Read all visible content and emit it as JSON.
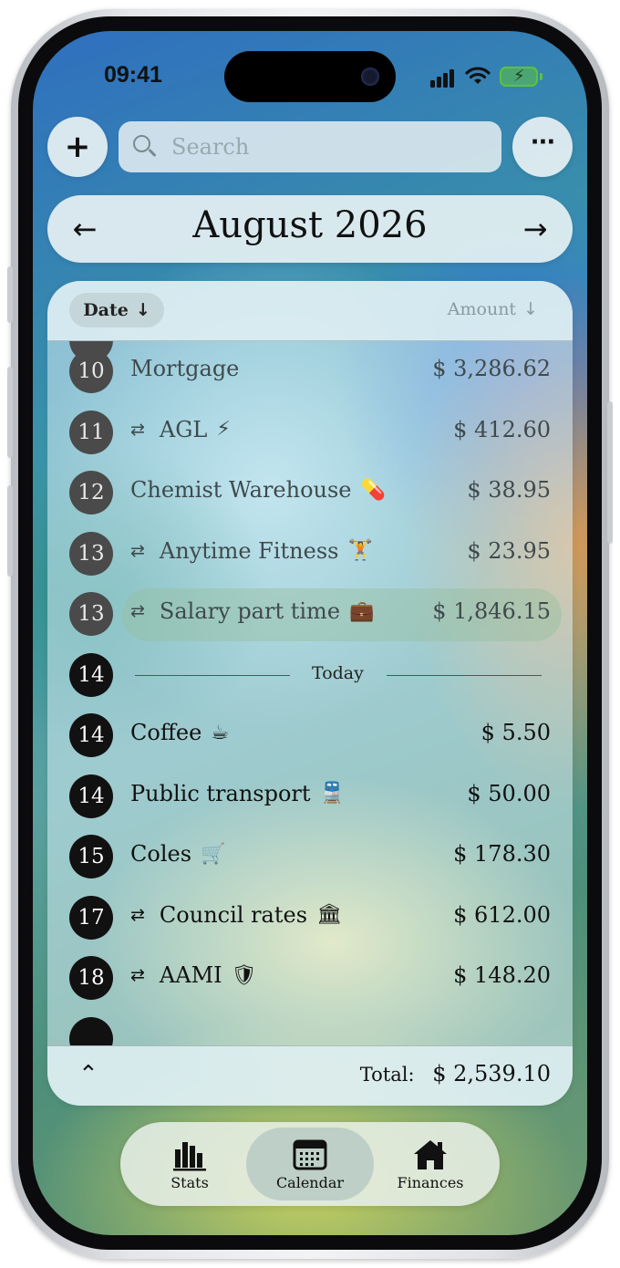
{
  "status": {
    "time": "09:41"
  },
  "top": {
    "search_placeholder": "Search",
    "add_label": "+",
    "more_label": "···"
  },
  "month": {
    "title": "August 2026",
    "prev": "←",
    "next": "→"
  },
  "sort": {
    "date_label": "Date",
    "amount_label": "Amount",
    "arrow": "↓"
  },
  "transactions": [
    {
      "day": "10",
      "name": "Mortgage",
      "emoji": "",
      "recurring": false,
      "amount": "$ 3,286.62",
      "state": "past"
    },
    {
      "day": "11",
      "name": "AGL",
      "emoji": "⚡",
      "recurring": true,
      "amount": "$ 412.60",
      "state": "past"
    },
    {
      "day": "12",
      "name": "Chemist Warehouse",
      "emoji": "💊",
      "recurring": false,
      "amount": "$ 38.95",
      "state": "past"
    },
    {
      "day": "13",
      "name": "Anytime Fitness",
      "emoji": "🏋",
      "recurring": true,
      "amount": "$ 23.95",
      "state": "past"
    },
    {
      "day": "13",
      "name": "Salary part time",
      "emoji": "💼",
      "recurring": true,
      "amount": "$ 1,846.15",
      "state": "past",
      "highlight": true
    },
    {
      "day": "14",
      "today_marker": "Today",
      "state": "now"
    },
    {
      "day": "14",
      "name": "Coffee",
      "emoji": "☕",
      "recurring": false,
      "amount": "$ 5.50",
      "state": "now"
    },
    {
      "day": "14",
      "name": "Public transport",
      "emoji": "🚆",
      "recurring": false,
      "amount": "$ 50.00",
      "state": "now"
    },
    {
      "day": "15",
      "name": "Coles",
      "emoji": "🛒",
      "recurring": false,
      "amount": "$ 178.30",
      "state": "now"
    },
    {
      "day": "17",
      "name": "Council rates",
      "emoji": "🏛",
      "recurring": true,
      "amount": "$ 612.00",
      "state": "now"
    },
    {
      "day": "18",
      "name": "AAMI",
      "emoji": "🛡",
      "recurring": true,
      "amount": "$ 148.20",
      "state": "now"
    }
  ],
  "footer": {
    "total_label": "Total:",
    "total_value": "$ 2,539.10"
  },
  "tabs": [
    {
      "label": "Stats",
      "icon": "bar-chart-icon"
    },
    {
      "label": "Calendar",
      "icon": "calendar-icon",
      "active": true
    },
    {
      "label": "Finances",
      "icon": "home-icon"
    }
  ],
  "colors": {
    "battery": "#5dc23c",
    "accent_dark": "#111111",
    "past_badge": "#4a4a4a"
  }
}
